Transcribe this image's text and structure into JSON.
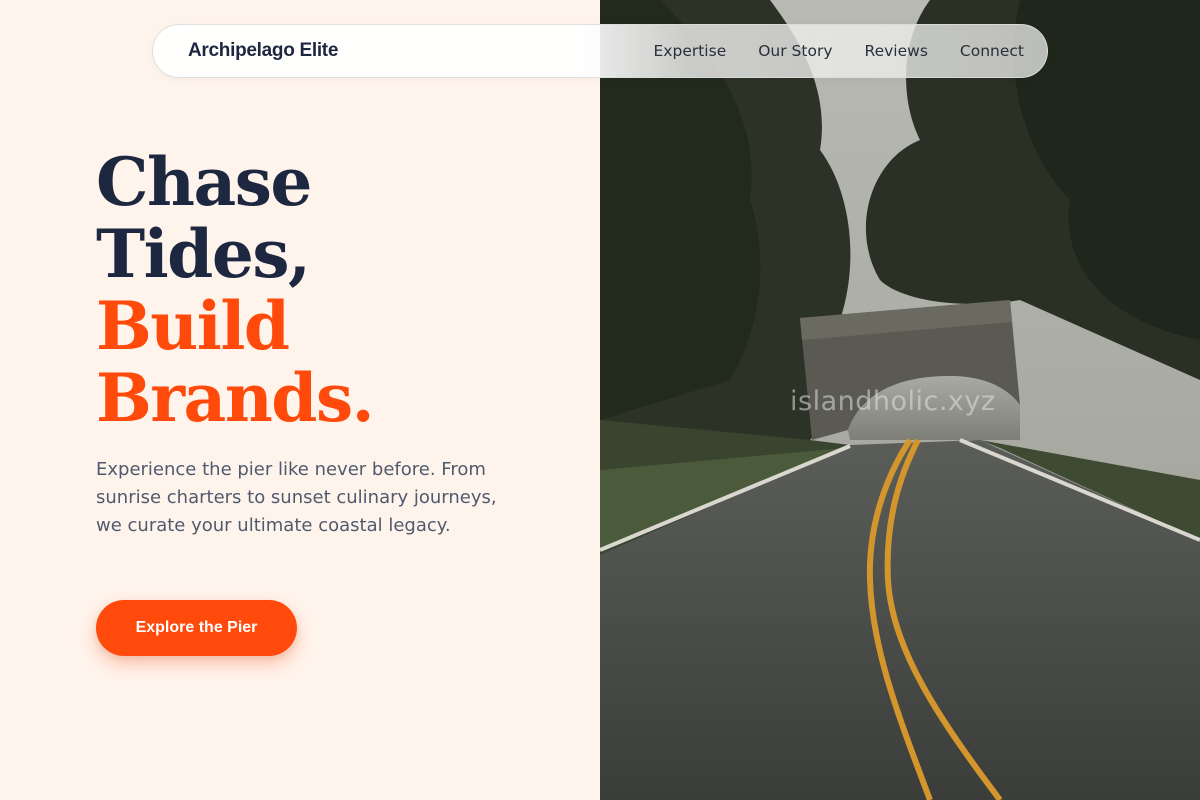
{
  "brand": {
    "name": "Archipelago Elite"
  },
  "nav": {
    "links": [
      {
        "label": "Expertise"
      },
      {
        "label": "Our Story"
      },
      {
        "label": "Reviews"
      },
      {
        "label": "Connect"
      }
    ]
  },
  "hero": {
    "title_lines": [
      "Chase",
      "Tides,",
      "Build",
      "Brands."
    ],
    "description": "Experience the pier like never before. From sunrise charters to sunset culinary journeys, we curate your ultimate coastal legacy.",
    "cta_label": "Explore the Pier"
  },
  "image": {
    "subject": "road-through-stone-bridge-photo",
    "watermark": "islandholic.xyz"
  },
  "colors": {
    "accent": "#ff4a0c",
    "heading": "#1e2740",
    "body_text": "#4f5a6e",
    "background": "#fff4ec"
  }
}
